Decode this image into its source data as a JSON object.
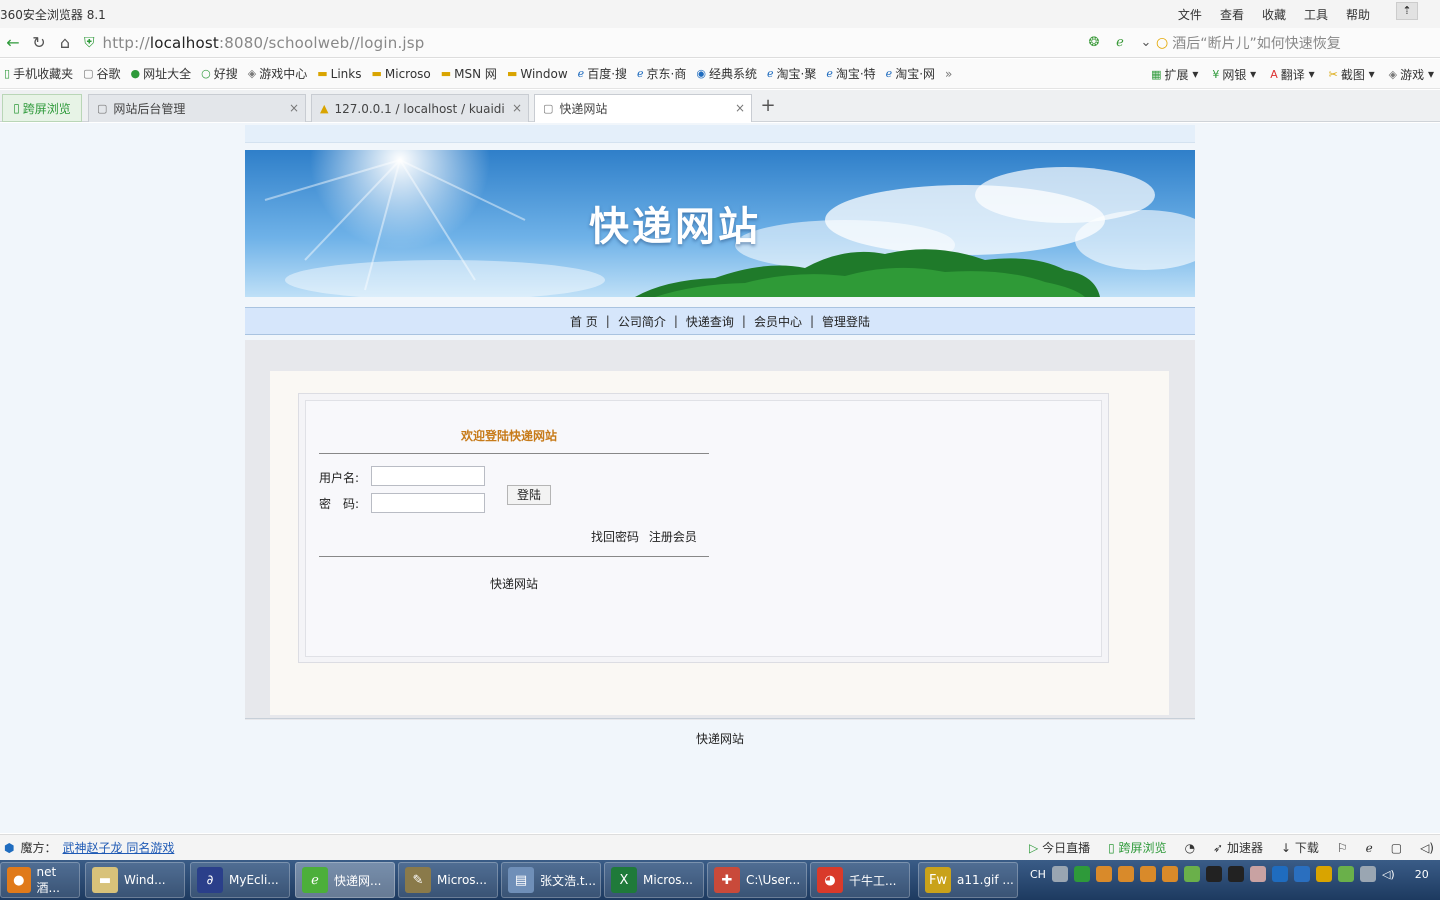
{
  "browser": {
    "app_title": "360安全浏览器 8.1",
    "menus": [
      "文件",
      "查看",
      "收藏",
      "工具",
      "帮助"
    ],
    "url_prefix": "http://",
    "url_host": "localhost",
    "url_rest": ":8080/schoolweb//login.jsp",
    "search_text": "酒后“断片儿”如何快速恢复"
  },
  "bookmarks": {
    "items": [
      "手机收藏夹",
      "谷歌",
      "网址大全",
      "好搜",
      "游戏中心",
      "Links",
      "Microso",
      "MSN 网",
      "Window",
      "百度·搜",
      "京东·商",
      "经典系统",
      "淘宝·聚",
      "淘宝·特",
      "淘宝·网"
    ],
    "right": [
      "扩展",
      "网银",
      "翻译",
      "截图",
      "游戏"
    ]
  },
  "tabs": {
    "side_label": "跨屏浏览",
    "items": [
      {
        "label": "网站后台管理"
      },
      {
        "label": "127.0.0.1 / localhost / kuaidi"
      },
      {
        "label": "快递网站"
      }
    ]
  },
  "site": {
    "title": "快递网站",
    "nav": [
      "首 页",
      "公司简介",
      "快递查询",
      "会员中心",
      "管理登陆"
    ],
    "login": {
      "welcome": "欢迎登陆快递网站",
      "username_label": "用户名:",
      "password_label": "密　码:",
      "username_value": "",
      "password_value": "",
      "submit": "登陆",
      "forgot": "找回密码",
      "register": "注册会员",
      "card_footer": "快递网站"
    },
    "footer": "快递网站"
  },
  "statusbar": {
    "left_label": "魔方：",
    "left_link": "武神赵子龙 同名游戏",
    "right": [
      "今日直播",
      "跨屏浏览",
      "加速器",
      "下载"
    ]
  },
  "taskbar": {
    "items": [
      {
        "label": "net 酒..."
      },
      {
        "label": "Wind..."
      },
      {
        "label": "MyEcli..."
      },
      {
        "label": "快递网..."
      },
      {
        "label": "Micros..."
      },
      {
        "label": "张文浩.t..."
      },
      {
        "label": "Micros..."
      },
      {
        "label": "C:\\User..."
      },
      {
        "label": "千牛工..."
      },
      {
        "label": "a11.gif ..."
      }
    ],
    "tray_lang": "CH",
    "clock": "20"
  },
  "colors": {
    "accent_green": "#2e9a3a",
    "welcome_orange": "#c77b1a",
    "nav_bg": "#d6e6fb",
    "taskbar": "#1d3a60"
  }
}
